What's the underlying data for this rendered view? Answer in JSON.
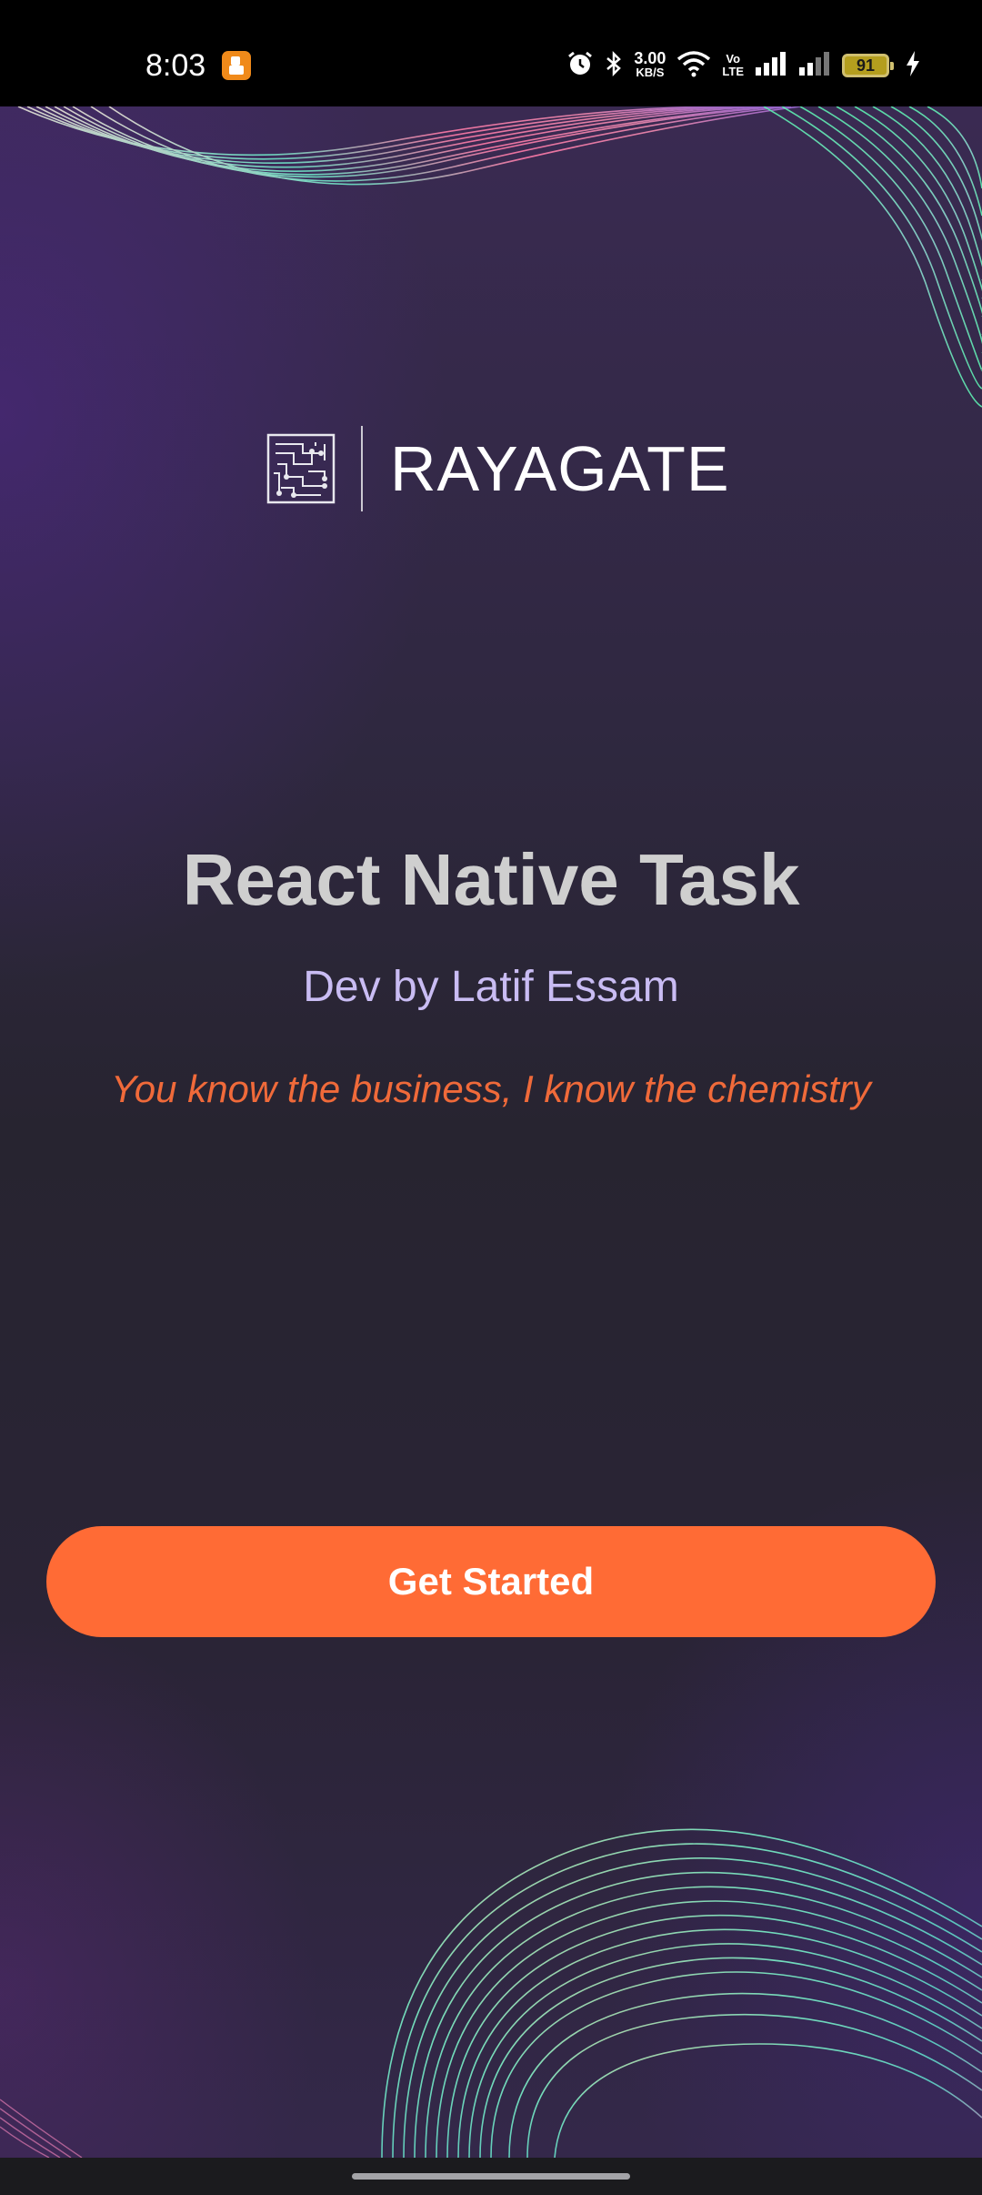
{
  "status_bar": {
    "time": "8:03",
    "net_speed_value": "3.00",
    "net_speed_unit": "KB/S",
    "volte_top": "Vo",
    "volte_bottom": "LTE",
    "battery_level": "91",
    "icons": [
      "notification-app-icon",
      "alarm-icon",
      "bluetooth-icon",
      "wifi-icon",
      "volte-icon",
      "signal-icon",
      "signal-icon",
      "battery-icon",
      "charging-icon"
    ]
  },
  "brand": {
    "name": "RAYAGATE",
    "logo_icon": "circuit-maze-icon"
  },
  "hero": {
    "title": "React Native Task",
    "subtitle": "Dev by Latif Essam",
    "tagline": "You know the business, I know the chemistry"
  },
  "cta": {
    "label": "Get Started"
  },
  "colors": {
    "accent": "#ff6b35",
    "subtitle": "#c9bcf3",
    "tagline": "#f06a3a",
    "title": "#cfcfcf",
    "background": "#2a2436"
  }
}
